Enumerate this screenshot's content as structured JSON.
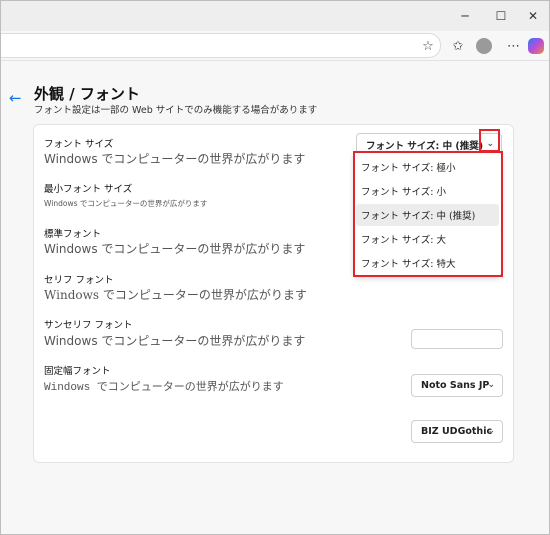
{
  "window": {
    "buttons": {
      "minimize": "─",
      "maximize": "☐",
      "close": "✕"
    }
  },
  "toolbar": {
    "icons": [
      "star-icon",
      "favorites-icon",
      "profile-icon",
      "more-icon",
      "copilot-icon"
    ],
    "favorite_glyph": "☆",
    "favorites_glyph": "✩",
    "more_glyph": "⋯"
  },
  "page": {
    "back_glyph": "←",
    "title": "外観 / フォント",
    "subtitle": "フォント設定は一部の Web サイトでのみ機能する場合があります"
  },
  "rows": [
    {
      "label": "フォント サイズ",
      "sample": "Windows でコンピューターの世界が広がります",
      "select": "フォント サイズ: 中 (推奨)"
    },
    {
      "label": "最小フォント サイズ",
      "sample": "Windows でコンピューターの世界が広がります"
    },
    {
      "label": "標準フォント",
      "sample": "Windows でコンピューターの世界が広がります"
    },
    {
      "label": "セリフ フォント",
      "sample": "Windows でコンピューターの世界が広がります"
    },
    {
      "label": "サンセリフ フォント",
      "sample": "Windows でコンピューターの世界が広がります",
      "select": "Noto Sans JP"
    },
    {
      "label": "固定幅フォント",
      "sample": "Windows でコンピューターの世界が広がります",
      "select": "BIZ UDGothic"
    }
  ],
  "dropdown": {
    "options": [
      "フォント サイズ: 極小",
      "フォント サイズ: 小",
      "フォント サイズ: 中 (推奨)",
      "フォント サイズ: 大",
      "フォント サイズ: 特大"
    ],
    "selected_index": 2
  },
  "chevron": "⌄",
  "colors": {
    "highlight": "#e0262c",
    "accent": "#1a73e8"
  }
}
